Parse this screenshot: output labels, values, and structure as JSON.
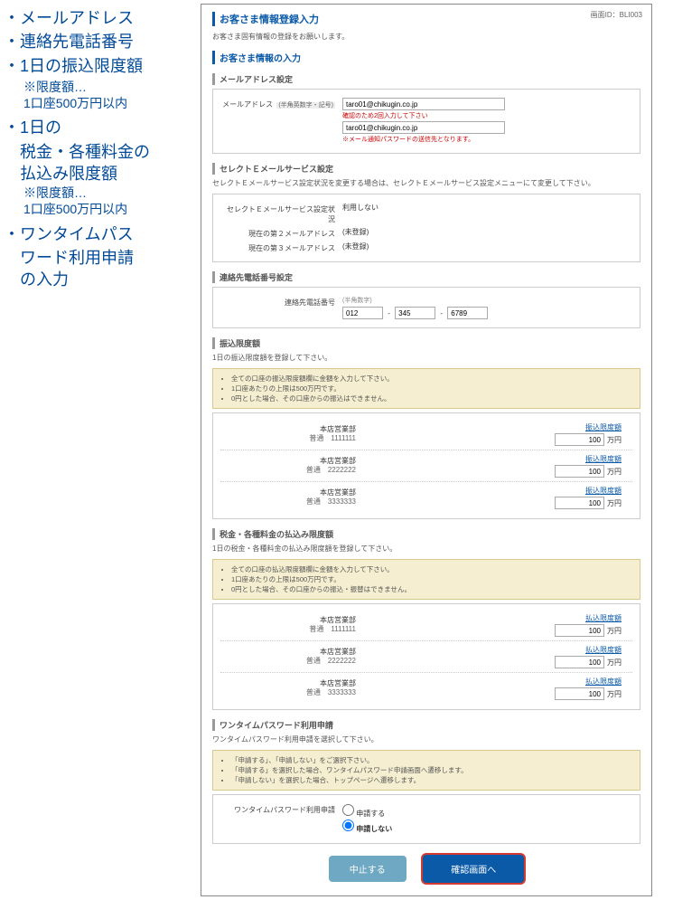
{
  "sidebar": {
    "items": [
      {
        "main": "・メールアドレス"
      },
      {
        "main": "・連絡先電話番号"
      },
      {
        "main": "・1日の振込限度額",
        "sub1": "※限度額…",
        "sub2": "1口座500万円以内"
      },
      {
        "main": "・1日の",
        "cont1": "税金・各種料金の",
        "cont2": "払込み限度額",
        "sub1": "※限度額…",
        "sub2": "1口座500万円以内"
      },
      {
        "main": "・ワンタイムパス",
        "cont1": "ワード利用申請",
        "cont2": "の入力"
      }
    ]
  },
  "screen": {
    "screen_id": "画面ID：BLI003",
    "title": "お客さま情報登録入力",
    "intro": "お客さま固有情報の登録をお願いします。",
    "section_input": "お客さま情報の入力",
    "mail": {
      "heading": "メールアドレス設定",
      "label": "メールアドレス",
      "req": "(半角英数字・記号)",
      "value": "taro01@chikugin.co.jp",
      "confirm_note": "確認のため2回入力して下さい",
      "confirm_value": "taro01@chikugin.co.jp",
      "warn": "※メール通知パスワードの送信先となります。"
    },
    "select_mail": {
      "heading": "セレクトＥメールサービス設定",
      "desc": "セレクトＥメールサービス設定状況を変更する場合は、セレクトＥメールサービス設定メニューにて変更して下さい。",
      "row1_label": "セレクトＥメールサービス設定状況",
      "row1_value": "利用しない",
      "row2_label": "現在の第２メールアドレス",
      "row2_value": "(未登録)",
      "row3_label": "現在の第３メールアドレス",
      "row3_value": "(未登録)"
    },
    "phone": {
      "heading": "連絡先電話番号設定",
      "label": "連絡先電話番号",
      "hint": "(半角数字)",
      "p1": "012",
      "p2": "345",
      "p3": "6789"
    },
    "transfer": {
      "heading": "振込限度額",
      "desc": "1日の振込限度額を登録して下さい。",
      "notes": [
        "全ての口座の振込限度額欄に金額を入力して下さい。",
        "1口座あたりの上限は500万円です。",
        "0円とした場合、その口座からの振込はできません。"
      ],
      "limit_label": "振込限度額",
      "unit": "万円",
      "accounts": [
        {
          "branch": "本店営業部",
          "type_num": "普通　1111111",
          "value": "100"
        },
        {
          "branch": "本店営業部",
          "type_num": "普通　2222222",
          "value": "100"
        },
        {
          "branch": "本店営業部",
          "type_num": "普通　3333333",
          "value": "100"
        }
      ]
    },
    "tax": {
      "heading": "税金・各種料金の払込み限度額",
      "desc": "1日の税金・各種料金の払込み限度額を登録して下さい。",
      "notes": [
        "全ての口座の払込限度額欄に金額を入力して下さい。",
        "1口座あたりの上限は500万円です。",
        "0円とした場合、その口座からの振込・振替はできません。"
      ],
      "limit_label": "払込限度額",
      "unit": "万円",
      "accounts": [
        {
          "branch": "本店営業部",
          "type_num": "普通　1111111",
          "value": "100"
        },
        {
          "branch": "本店営業部",
          "type_num": "普通　2222222",
          "value": "100"
        },
        {
          "branch": "本店営業部",
          "type_num": "普通　3333333",
          "value": "100"
        }
      ]
    },
    "otp": {
      "heading": "ワンタイムパスワード利用申請",
      "desc": "ワンタイムパスワード利用申請を選択して下さい。",
      "notes": [
        "「申請する」、「申請しない」をご選択下さい。",
        "「申請する」を選択した場合、ワンタイムパスワード申請画面へ遷移します。",
        "「申請しない」を選択した場合、トップページへ遷移します。"
      ],
      "label": "ワンタイムパスワード利用申請",
      "opt1": "申請する",
      "opt2": "申請しない"
    },
    "buttons": {
      "cancel": "中止する",
      "confirm": "確認画面へ"
    }
  }
}
